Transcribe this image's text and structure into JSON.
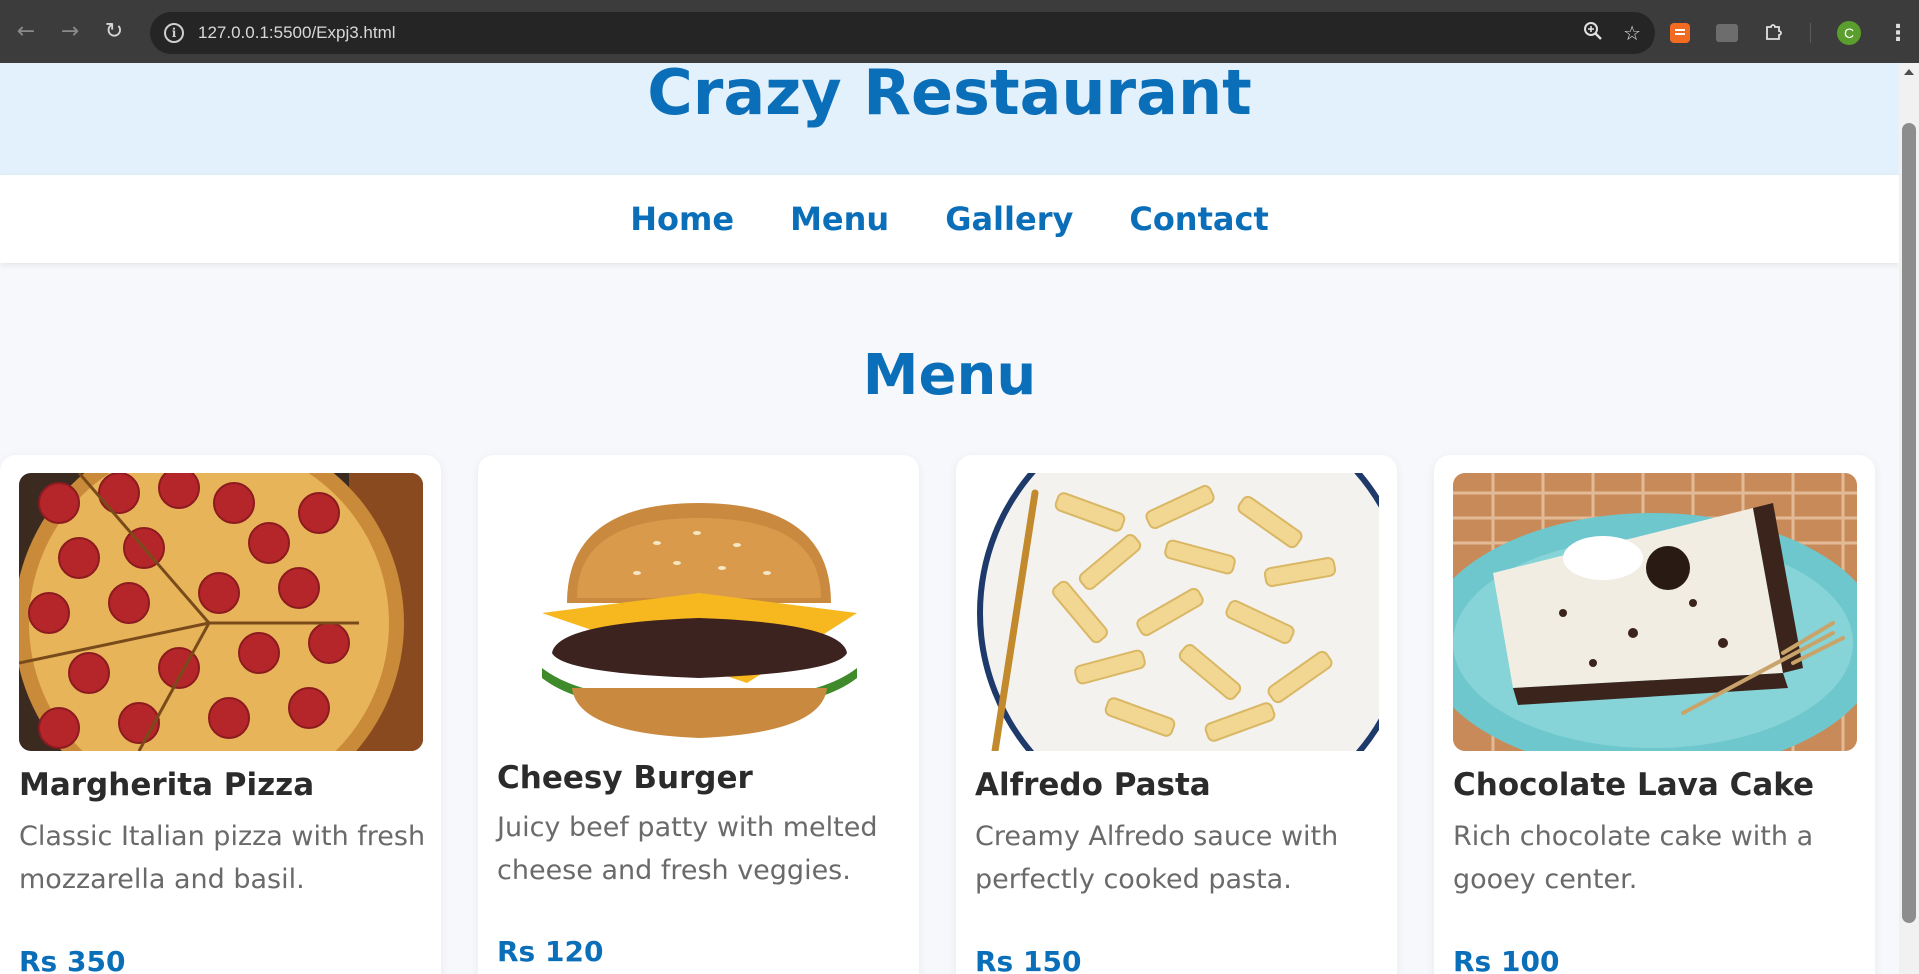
{
  "browser": {
    "url": "127.0.0.1:5500/Expj3.html",
    "profile_initial": "C",
    "icons": [
      "back-arrow-icon",
      "forward-arrow-icon",
      "reload-icon",
      "site-info-icon",
      "zoom-icon",
      "bookmark-star-icon",
      "extension-icon",
      "puzzle-icon",
      "kebab-menu-icon"
    ]
  },
  "site": {
    "title": "Crazy Restaurant",
    "nav": [
      "Home",
      "Menu",
      "Gallery",
      "Contact"
    ]
  },
  "menu": {
    "title": "Menu",
    "items": [
      {
        "name": "Margherita Pizza",
        "description": "Classic Italian pizza with fresh mozzarella and basil.",
        "price": "Rs 350",
        "image": "pizza"
      },
      {
        "name": "Cheesy Burger",
        "description": "Juicy beef patty with melted cheese and fresh veggies.",
        "price": "Rs 120",
        "image": "burger"
      },
      {
        "name": "Alfredo Pasta",
        "description": "Creamy Alfredo sauce with perfectly cooked pasta.",
        "price": "Rs 150",
        "image": "pasta"
      },
      {
        "name": "Chocolate Lava Cake",
        "description": "Rich chocolate cake with a gooey center.",
        "price": "Rs 100",
        "image": "cake"
      }
    ]
  },
  "colors": {
    "brand_blue": "#0a6fb8",
    "header_bg": "#e3f1fc",
    "page_bg": "#f6f8fb"
  }
}
